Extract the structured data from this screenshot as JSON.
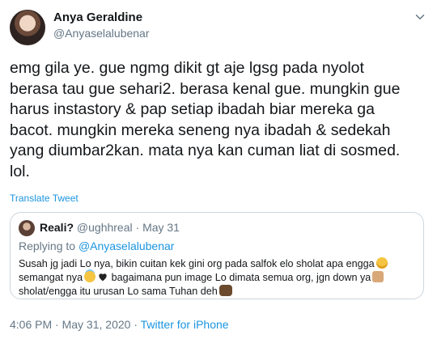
{
  "tweet": {
    "author_name": "Anya Geraldine",
    "author_handle": "@Anyaselalubenar",
    "text": "emg gila ye. gue ngmg dikit gt aje lgsg pada nyolot\nberasa tau gue sehari2. berasa kenal gue. mungkin gue\nharus instastory & pap setiap ibadah biar mereka ga\nbacot. mungkin mereka seneng nya ibadah & sedekah\nyang diumbar2kan. mata nya kan cuman liat di sosmed.\nlol.",
    "translate_label": "Translate Tweet"
  },
  "quote": {
    "author_name": "Reali?",
    "author_handle": "@ughhreal",
    "separator": " · ",
    "date": "May 31",
    "replying_prefix": "Replying to ",
    "replying_to": "@Anyaselalubenar",
    "lines": [
      "Susah jg jadi Lo nya, bikin cuitan kek gini org pada salfok elo sholat apa engga",
      "semangat nya",
      "bagaimana pun image Lo dimata semua org, jgn down ya",
      "sholat/engga itu urusan Lo sama Tuhan deh"
    ],
    "emojis": [
      "weary-face-emoji",
      "halo-face-emoji",
      "black-heart-emoji",
      "thumbs-up-emoji",
      "palms-up-emoji"
    ]
  },
  "footer": {
    "time": "4:06 PM",
    "separator": " · ",
    "date": "May 31, 2020",
    "source": "Twitter for iPhone"
  },
  "colors": {
    "link": "#1b95e0",
    "muted": "#657786",
    "text": "#14171a",
    "border": "#ccd6dd"
  }
}
